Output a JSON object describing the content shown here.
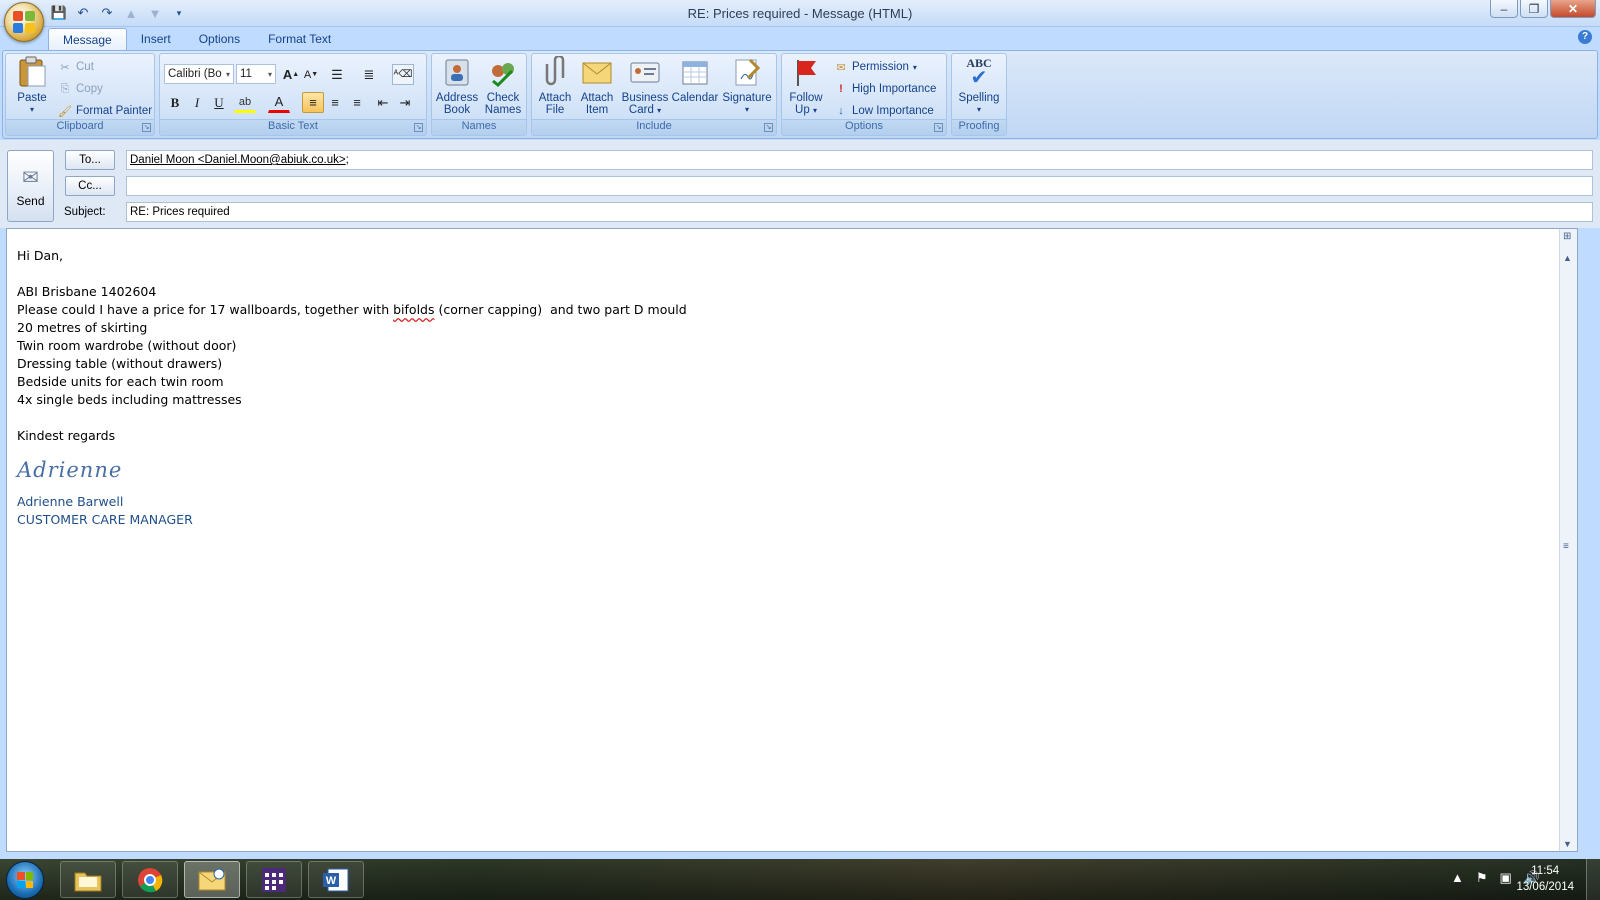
{
  "window": {
    "title": "RE: Prices required - Message (HTML)",
    "controls": [
      "–",
      "❐",
      "✕"
    ]
  },
  "ribbon_tabs": [
    "Message",
    "Insert",
    "Options",
    "Format Text"
  ],
  "clipboard": {
    "label": "Clipboard",
    "paste": "Paste",
    "cut": "Cut",
    "copy": "Copy",
    "format_painter": "Format Painter"
  },
  "basic_text": {
    "label": "Basic Text",
    "font_name": "Calibri (Bo",
    "font_size": "11",
    "bold": "B",
    "italic": "I",
    "underline": "U"
  },
  "names": {
    "label": "Names",
    "address_book": [
      "Address",
      "Book"
    ],
    "check_names": [
      "Check",
      "Names"
    ]
  },
  "include": {
    "label": "Include",
    "attach_file": [
      "Attach",
      "File"
    ],
    "attach_item": [
      "Attach",
      "Item"
    ],
    "business_card": [
      "Business",
      "Card"
    ],
    "calendar": "Calendar",
    "signature": "Signature"
  },
  "options": {
    "label": "Options",
    "follow_up": [
      "Follow",
      "Up"
    ],
    "permission": "Permission",
    "high_importance": "High Importance",
    "low_importance": "Low Importance"
  },
  "proofing": {
    "label": "Proofing",
    "spelling": "Spelling",
    "abc": "ABC"
  },
  "header": {
    "send": "Send",
    "to_button": "To...",
    "cc_button": "Cc...",
    "subject_label": "Subject:",
    "to_value": "Daniel Moon <Daniel.Moon@abiuk.co.uk>",
    "to_sep": ";",
    "cc_value": "",
    "subject_value": "RE: Prices required"
  },
  "message": {
    "greeting": "Hi Dan,",
    "ref": "ABI Brisbane 1402604",
    "line1_a": "Please could I have a price for 17 wallboards, together with ",
    "line1_b": "bifolds",
    "line1_c": " (corner capping)  and two part D mould",
    "items": [
      "20 metres of skirting",
      "Twin room wardrobe (without door)",
      "Dressing table (without drawers)",
      "Bedside units for each twin room",
      "4x single beds including mattresses"
    ],
    "closing": "Kindest regards",
    "signature_script": "Adrienne",
    "sender_name": "Adrienne Barwell",
    "sender_title": "CUSTOMER CARE MANAGER"
  },
  "taskbar": {
    "apps": [
      "windows-explorer",
      "google-chrome",
      "outlook",
      "calendar-app",
      "microsoft-word"
    ],
    "time": "11:54",
    "date": "13/06/2014"
  },
  "colors": {
    "ribbon": "#c8dcf6",
    "accent": "#15428b",
    "signature": "#1f4e8a"
  }
}
